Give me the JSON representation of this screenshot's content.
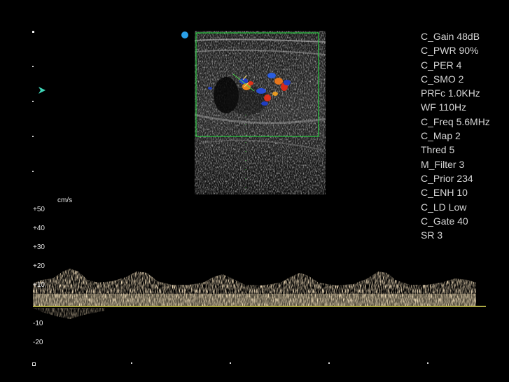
{
  "image_settings": {
    "params": [
      "C_Gain 48dB",
      "C_PWR 90%",
      "C_PER 4",
      "C_SMO 2",
      "PRFc 1.0KHz",
      "WF 110Hz",
      "C_Freq 5.6MHz",
      "C_Map 2",
      "Thred 5",
      "M_Filter 3",
      "C_Prior 234",
      "C_ENH 10",
      "C_LD Low",
      "C_Gate 40",
      "SR 3"
    ]
  },
  "spectral": {
    "unit": "cm/s",
    "ticks": [
      "+50",
      "+40",
      "+30",
      "+20",
      "+10",
      "-10",
      "-20"
    ]
  },
  "colors": {
    "background": "#000000",
    "roi_box": "#27c93f",
    "baseline": "#e8e25a",
    "spectrum": "#c9a878",
    "focus_marker": "#2aa0e8",
    "depth_marker": "#3fd6b8"
  }
}
